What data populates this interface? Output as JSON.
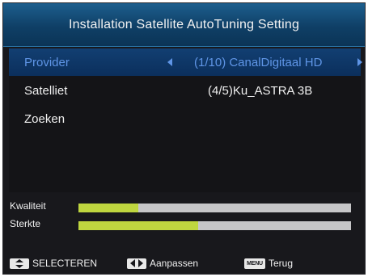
{
  "header": {
    "title": "Installation Satellite AutoTuning Setting"
  },
  "menu": {
    "rows": [
      {
        "label": "Provider",
        "value": "(1/10)  CanalDigitaal HD",
        "selected": true
      },
      {
        "label": "Satelliet",
        "value": "(4/5)Ku_ASTRA 3B",
        "selected": false
      },
      {
        "label": "Zoeken",
        "value": "",
        "selected": false
      }
    ]
  },
  "signal": {
    "quality": {
      "label": "Kwaliteit",
      "level_percent": 22
    },
    "strength": {
      "label": "Sterkte",
      "level_percent": 44
    }
  },
  "footer": {
    "hints": [
      {
        "icon": "up-down-key-icon",
        "label": "SELECTEREN"
      },
      {
        "icon": "left-right-key-icon",
        "label": "Aanpassen"
      },
      {
        "icon": "menu-key-icon",
        "key_text": "MENU",
        "label": "Terug"
      }
    ]
  },
  "colors": {
    "title_bar": "#0f3f66",
    "selected_row": "#0b2f5c",
    "selected_text": "#5f95e6",
    "meter_fill": "#bfd63f",
    "meter_track": "#c6c6c8"
  }
}
